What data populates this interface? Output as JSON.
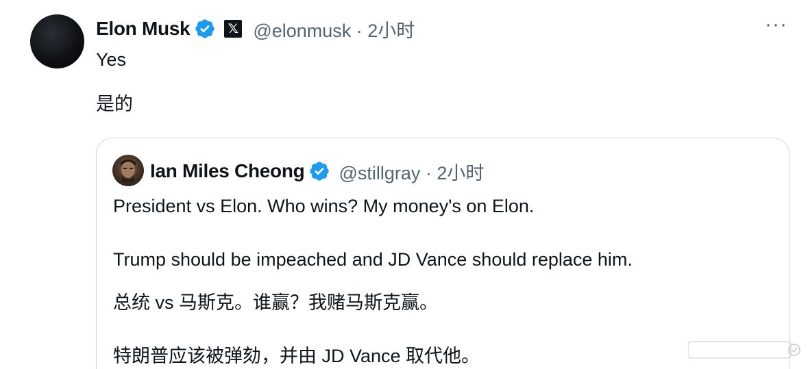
{
  "main_post": {
    "author_name": "Elon Musk",
    "handle_time": "@elonmusk · 2小时",
    "x_badge": "𝕏",
    "more": "···",
    "lines": [
      "Yes",
      "是的"
    ]
  },
  "quoted_post": {
    "author_name": "Ian Miles Cheong",
    "handle_time": "@stillgray · 2小时",
    "lines": [
      "President vs Elon. Who wins? My money's on Elon.",
      "Trump should be impeached and JD Vance should replace him.",
      "总统 vs 马斯克。谁赢？我赌马斯克赢。",
      "特朗普应该被弹劾，并由 JD Vance 取代他。"
    ]
  },
  "colors": {
    "verified": "#1d9bf0",
    "text": "#0f1419",
    "muted": "#536471",
    "border": "#cfd9de"
  },
  "icons": [
    "verified-badge-icon",
    "x-logo-icon",
    "more-icon"
  ]
}
